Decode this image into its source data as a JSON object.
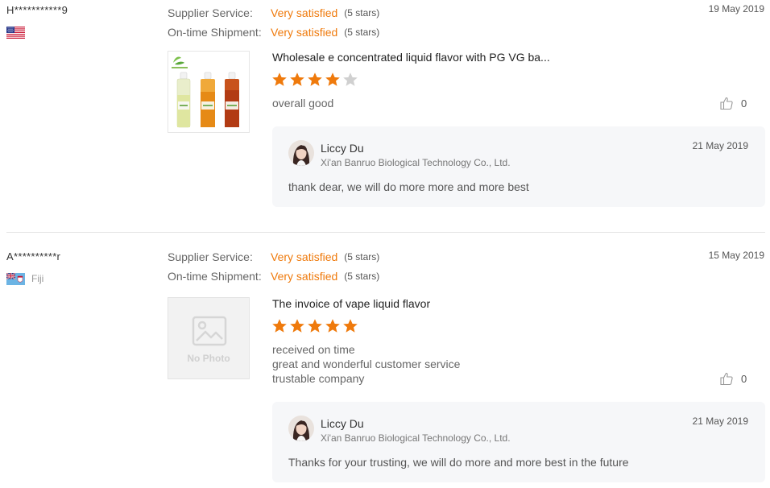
{
  "labels": {
    "supplier_service": "Supplier Service:",
    "ontime_shipment": "On-time Shipment:"
  },
  "colors": {
    "accent": "#ef7a0c",
    "star_empty": "#d0d0d0",
    "reply_bg": "#f6f7f9"
  },
  "reviews": [
    {
      "buyer": "H***********9",
      "country_flag": "us-flag-icon",
      "country": "",
      "supplier_service_value": "Very satisfied",
      "supplier_service_stars": "(5 stars)",
      "shipment_value": "Very satisfied",
      "shipment_stars": "(5 stars)",
      "date": "19 May 2019",
      "product_image": "product-bottles-image",
      "product_title": "Wholesale e concentrated liquid flavor with PG VG ba...",
      "rating": 4,
      "rating_max": 5,
      "comment": [
        "overall good"
      ],
      "likes": "0",
      "reply": {
        "name": "Liccy Du",
        "company": "Xi'an Banruo Biological Technology Co., Ltd.",
        "date": "21 May 2019",
        "text": "thank dear, we will do more more and more best"
      }
    },
    {
      "buyer": "A**********r",
      "country_flag": "fiji-flag-icon",
      "country": "Fiji",
      "supplier_service_value": "Very satisfied",
      "supplier_service_stars": "(5 stars)",
      "shipment_value": "Very satisfied",
      "shipment_stars": "(5 stars)",
      "date": "15 May 2019",
      "product_image": "no-photo-placeholder",
      "no_photo_label": "No Photo",
      "product_title": "The invoice of vape liquid flavor",
      "rating": 5,
      "rating_max": 5,
      "comment": [
        "received on time",
        "great and wonderful customer service",
        "trustable company"
      ],
      "likes": "0",
      "reply": {
        "name": "Liccy Du",
        "company": "Xi'an Banruo Biological Technology Co., Ltd.",
        "date": "21 May 2019",
        "text": "Thanks for your trusting, we will do more and more best in the future"
      }
    }
  ]
}
